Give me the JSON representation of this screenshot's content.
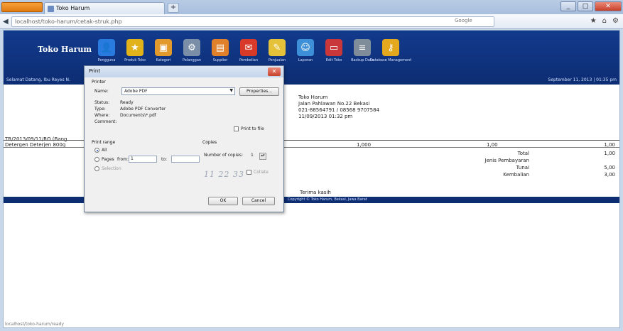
{
  "browser": {
    "tab_title": "Toko Harum",
    "new_tab": "+",
    "url": "localhost/toko-harum/cetak-struk.php",
    "search_placeholder": "Google",
    "back": "◀",
    "win_min": "_",
    "win_max": "□",
    "win_close": "✕",
    "nav_icons": [
      "★",
      "⌂",
      "⚙"
    ]
  },
  "app": {
    "brand": "Toko Harum",
    "user_line": "Selamat Datang, Ibu Reyes N.",
    "date_line": "September 11, 2013 | 01:35 pm",
    "toolbar": [
      {
        "label": "Pengguna",
        "icon": "user-icon",
        "color": "#2a7be0",
        "glyph": "👤"
      },
      {
        "label": "Produk Toko",
        "icon": "star-badge-icon",
        "color": "#e2b21b",
        "glyph": "★"
      },
      {
        "label": "Kategori",
        "icon": "box-icon",
        "color": "#e39a2c",
        "glyph": "▣"
      },
      {
        "label": "Pelanggan",
        "icon": "settings-icon",
        "color": "#7a8ea8",
        "glyph": "⚙"
      },
      {
        "label": "Supplier",
        "icon": "folder-icon",
        "color": "#e0802b",
        "glyph": "▤"
      },
      {
        "label": "Pembelian",
        "icon": "cart-icon",
        "color": "#d83a2a",
        "glyph": "✉"
      },
      {
        "label": "Penjualan",
        "icon": "note-icon",
        "color": "#e5c23a",
        "glyph": "✎"
      },
      {
        "label": "Laporan",
        "icon": "people-icon",
        "color": "#3d8fd8",
        "glyph": "☺"
      },
      {
        "label": "Edit Toko",
        "icon": "window-icon",
        "color": "#c9373a",
        "glyph": "▭"
      },
      {
        "label": "Backup Data",
        "icon": "database-icon",
        "color": "#7f8c9a",
        "glyph": "≡"
      },
      {
        "label": "Database Management",
        "icon": "key-icon",
        "color": "#e3a81d",
        "glyph": "⚷"
      }
    ]
  },
  "receipt": {
    "store": "Toko Harum",
    "address": "Jalan Pahlawan No.22 Bekasi",
    "phone": "021-88564791 / 08568 9707584",
    "datetime": "11/09/2013 01:32 pm",
    "ref": "TR/2013/09/11/RO (Bang",
    "item": "Detergen Deterjen 800g",
    "qty": "1,000",
    "price": "1,00",
    "amount": "1,00",
    "total_label": "Total",
    "discount_label": "Jenis Pembayaran",
    "cash_label": "Tunai",
    "change_label": "Kembalian",
    "total_val": "1,00",
    "cash_val": "5,00",
    "change_val": "3,00",
    "thanks": "Terima kasih",
    "footer": "Copyright © Toko Harum, Bekasi, Jawa Barat"
  },
  "print_dialog": {
    "title": "Print",
    "printer_group": "Printer",
    "name_label": "Name:",
    "printer_name": "Adobe PDF",
    "properties_button": "Properties...",
    "status_label": "Status:",
    "status_val": "Ready",
    "type_label": "Type:",
    "type_val": "Adobe PDF Converter",
    "where_label": "Where:",
    "where_val": "Documents\\*.pdf",
    "comment_label": "Comment:",
    "print_to_file": "Print to file",
    "range_group": "Print range",
    "range_all": "All",
    "range_pages": "Pages",
    "from_label": "from:",
    "from_val": "1",
    "to_label": "to:",
    "to_val": "",
    "range_selection": "Selection",
    "copies_group": "Copies",
    "copies_label": "Number of copies:",
    "copies_val": "1",
    "collate": "Collate",
    "collate_art": "11 22 33",
    "ok": "OK",
    "cancel": "Cancel"
  },
  "status_bar": "localhost/toko-harum/ready"
}
